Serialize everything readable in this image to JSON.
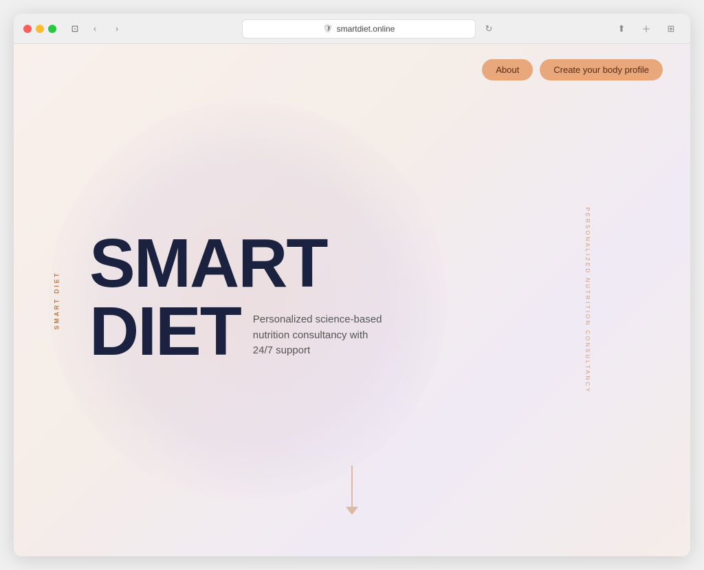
{
  "browser": {
    "url": "smartdiet.online",
    "back_btn": "‹",
    "forward_btn": "›"
  },
  "nav": {
    "about_label": "About",
    "cta_label": "Create your body profile"
  },
  "hero": {
    "title_line1": "SMART",
    "title_line2": "DIET",
    "description": "Personalized science-based nutrition consultancy with 24/7 support"
  },
  "side_labels": {
    "left": "SMART DIET",
    "right": "PERSONALIZED NUTRITION CONSULTANCY"
  },
  "colors": {
    "accent": "#c07840",
    "button_bg": "#e8a87c",
    "title_dark": "#1a2240",
    "bg": "#faf5f2"
  }
}
